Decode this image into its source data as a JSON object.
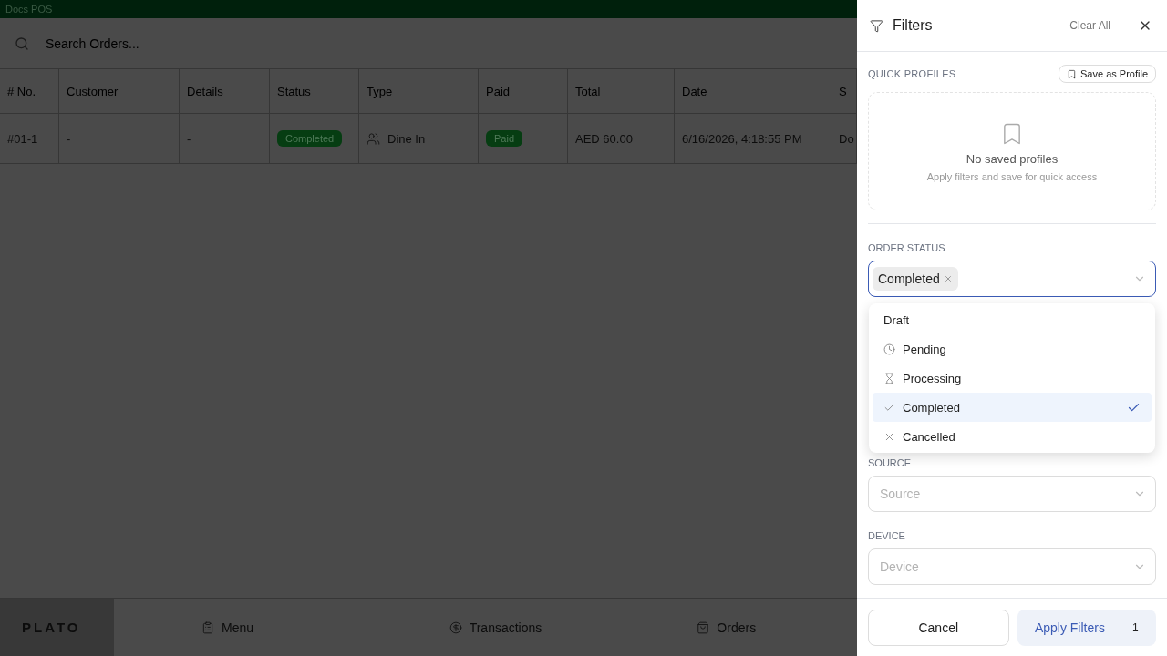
{
  "app": {
    "title": "Docs POS"
  },
  "search": {
    "placeholder": "Search Orders..."
  },
  "table": {
    "columns": [
      "# No.",
      "Customer",
      "Details",
      "Status",
      "Type",
      "Paid",
      "Total",
      "Date",
      "S"
    ],
    "rows": [
      {
        "cells": [
          {
            "kind": "text",
            "text": "#01-1"
          },
          {
            "kind": "text",
            "text": "-"
          },
          {
            "kind": "text",
            "text": "-"
          },
          {
            "kind": "badge",
            "text": "Completed"
          },
          {
            "kind": "type",
            "text": "Dine In"
          },
          {
            "kind": "badge",
            "text": "Paid"
          },
          {
            "kind": "text",
            "text": "AED 60.00"
          },
          {
            "kind": "text",
            "text": "6/16/2026, 4:18:55 PM"
          },
          {
            "kind": "text",
            "text": "Do"
          }
        ]
      }
    ]
  },
  "bottom_nav": {
    "logo": "PLATO",
    "items": [
      {
        "kind": "menu",
        "label": "Menu"
      },
      {
        "kind": "transactions",
        "label": "Transactions"
      },
      {
        "kind": "orders",
        "label": "Orders"
      }
    ]
  },
  "filters": {
    "title": "Filters",
    "clear_all": "Clear All",
    "quick_profiles": {
      "label": "QUICK PROFILES",
      "save_button": "Save as Profile",
      "empty_title": "No saved profiles",
      "empty_hint": "Apply filters and save for quick access"
    },
    "order_status": {
      "label": "ORDER STATUS",
      "chips": [
        "Completed"
      ],
      "expanded": true,
      "options": [
        {
          "kind": "draft",
          "label": "Draft",
          "selected": false
        },
        {
          "kind": "pending",
          "label": "Pending",
          "selected": false
        },
        {
          "kind": "processing",
          "label": "Processing",
          "selected": false
        },
        {
          "kind": "completed",
          "label": "Completed",
          "selected": true
        },
        {
          "kind": "cancelled",
          "label": "Cancelled",
          "selected": false
        }
      ]
    },
    "source": {
      "label": "SOURCE",
      "placeholder": "Source"
    },
    "device": {
      "label": "DEVICE",
      "placeholder": "Device"
    },
    "cancel": "Cancel",
    "apply": "Apply Filters",
    "apply_count": "1"
  }
}
